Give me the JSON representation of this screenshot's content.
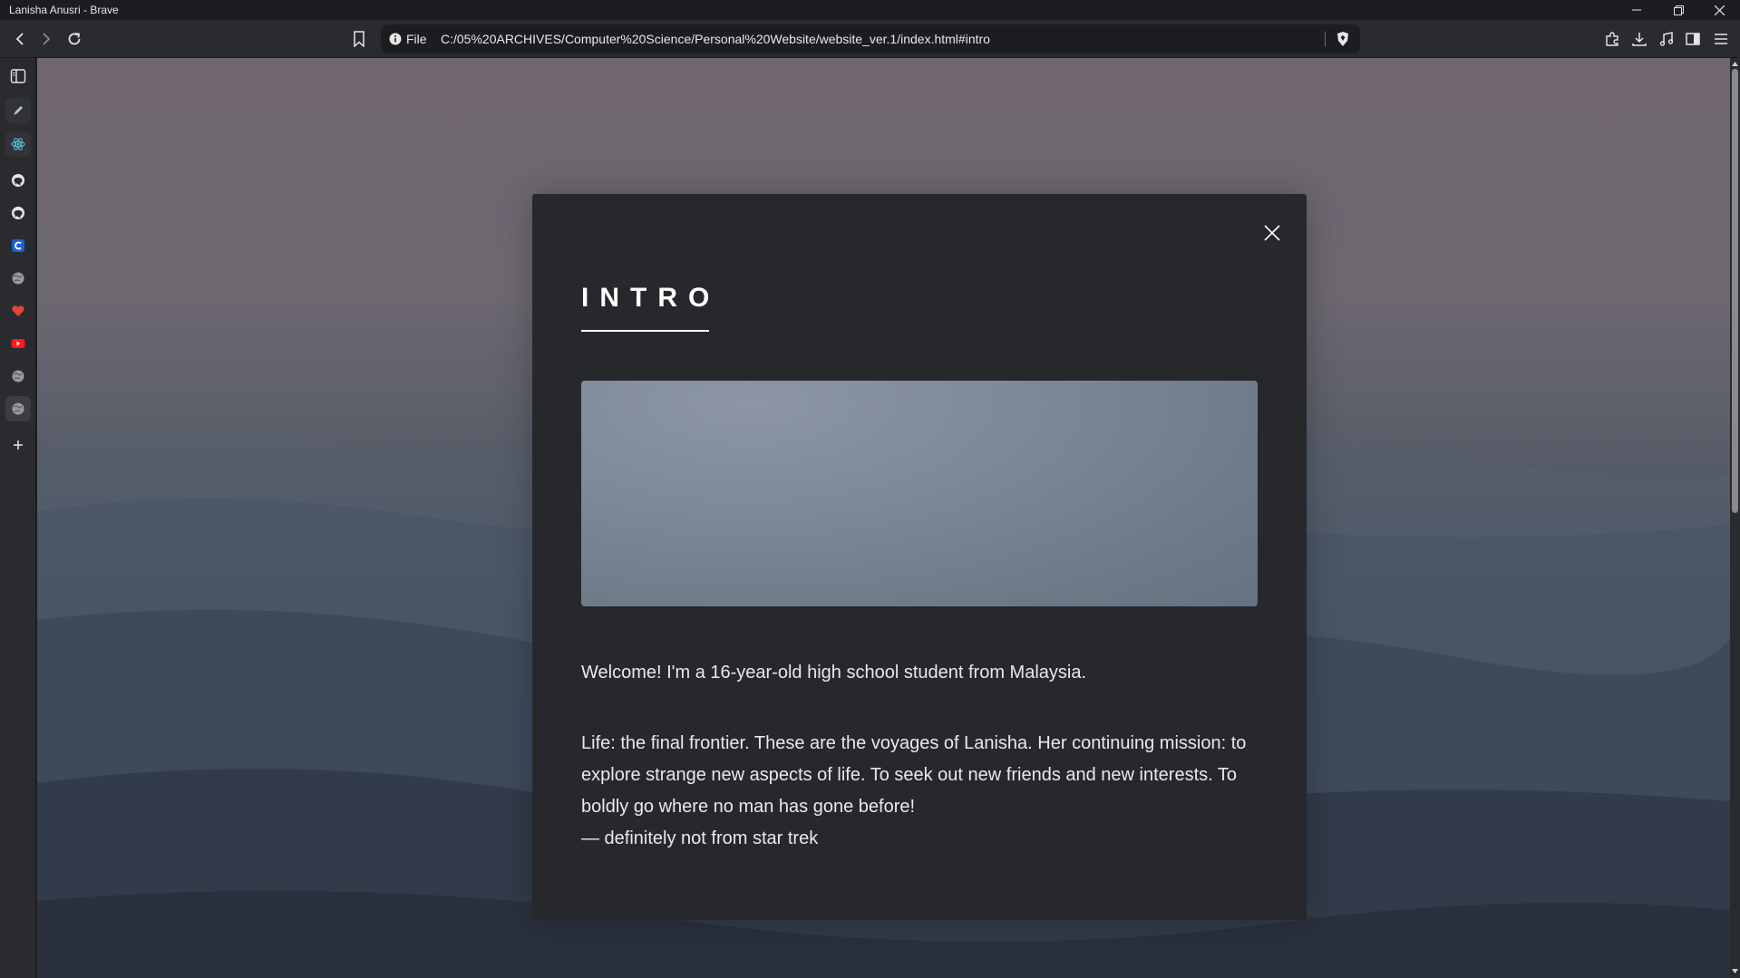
{
  "window": {
    "title": "Lanisha Anusri - Brave"
  },
  "toolbar": {
    "file_label": "File",
    "url": "C:/05%20ARCHIVES/Computer%20Science/Personal%20Website/website_ver.1/index.html#intro"
  },
  "sidebar": {
    "items": [
      {
        "icon": "sidebar-toggle-icon"
      },
      {
        "icon": "pen-icon"
      },
      {
        "icon": "atom-icon"
      },
      {
        "icon": "github-icon"
      },
      {
        "icon": "github-icon"
      },
      {
        "icon": "c-icon"
      },
      {
        "icon": "globe-icon"
      },
      {
        "icon": "heart-icon"
      },
      {
        "icon": "youtube-icon"
      },
      {
        "icon": "globe-icon"
      },
      {
        "icon": "globe-icon"
      },
      {
        "icon": "plus-icon"
      }
    ]
  },
  "modal": {
    "title": "INTRO",
    "paragraph1": "Welcome! I'm a 16-year-old high school student from Malaysia.",
    "paragraph2_line1": "Life: the final frontier. These are the voyages of Lanisha. Her continuing mission: to",
    "paragraph2_line2": "explore strange new aspects of life. To seek out new friends and new interests. To",
    "paragraph2_line3": "boldly go where no man has gone before!",
    "paragraph2_line4": "— definitely not from star trek"
  },
  "colors": {
    "modal_bg": "#27282c",
    "text": "#e9e9ea",
    "chrome": "#2a2b2f"
  }
}
